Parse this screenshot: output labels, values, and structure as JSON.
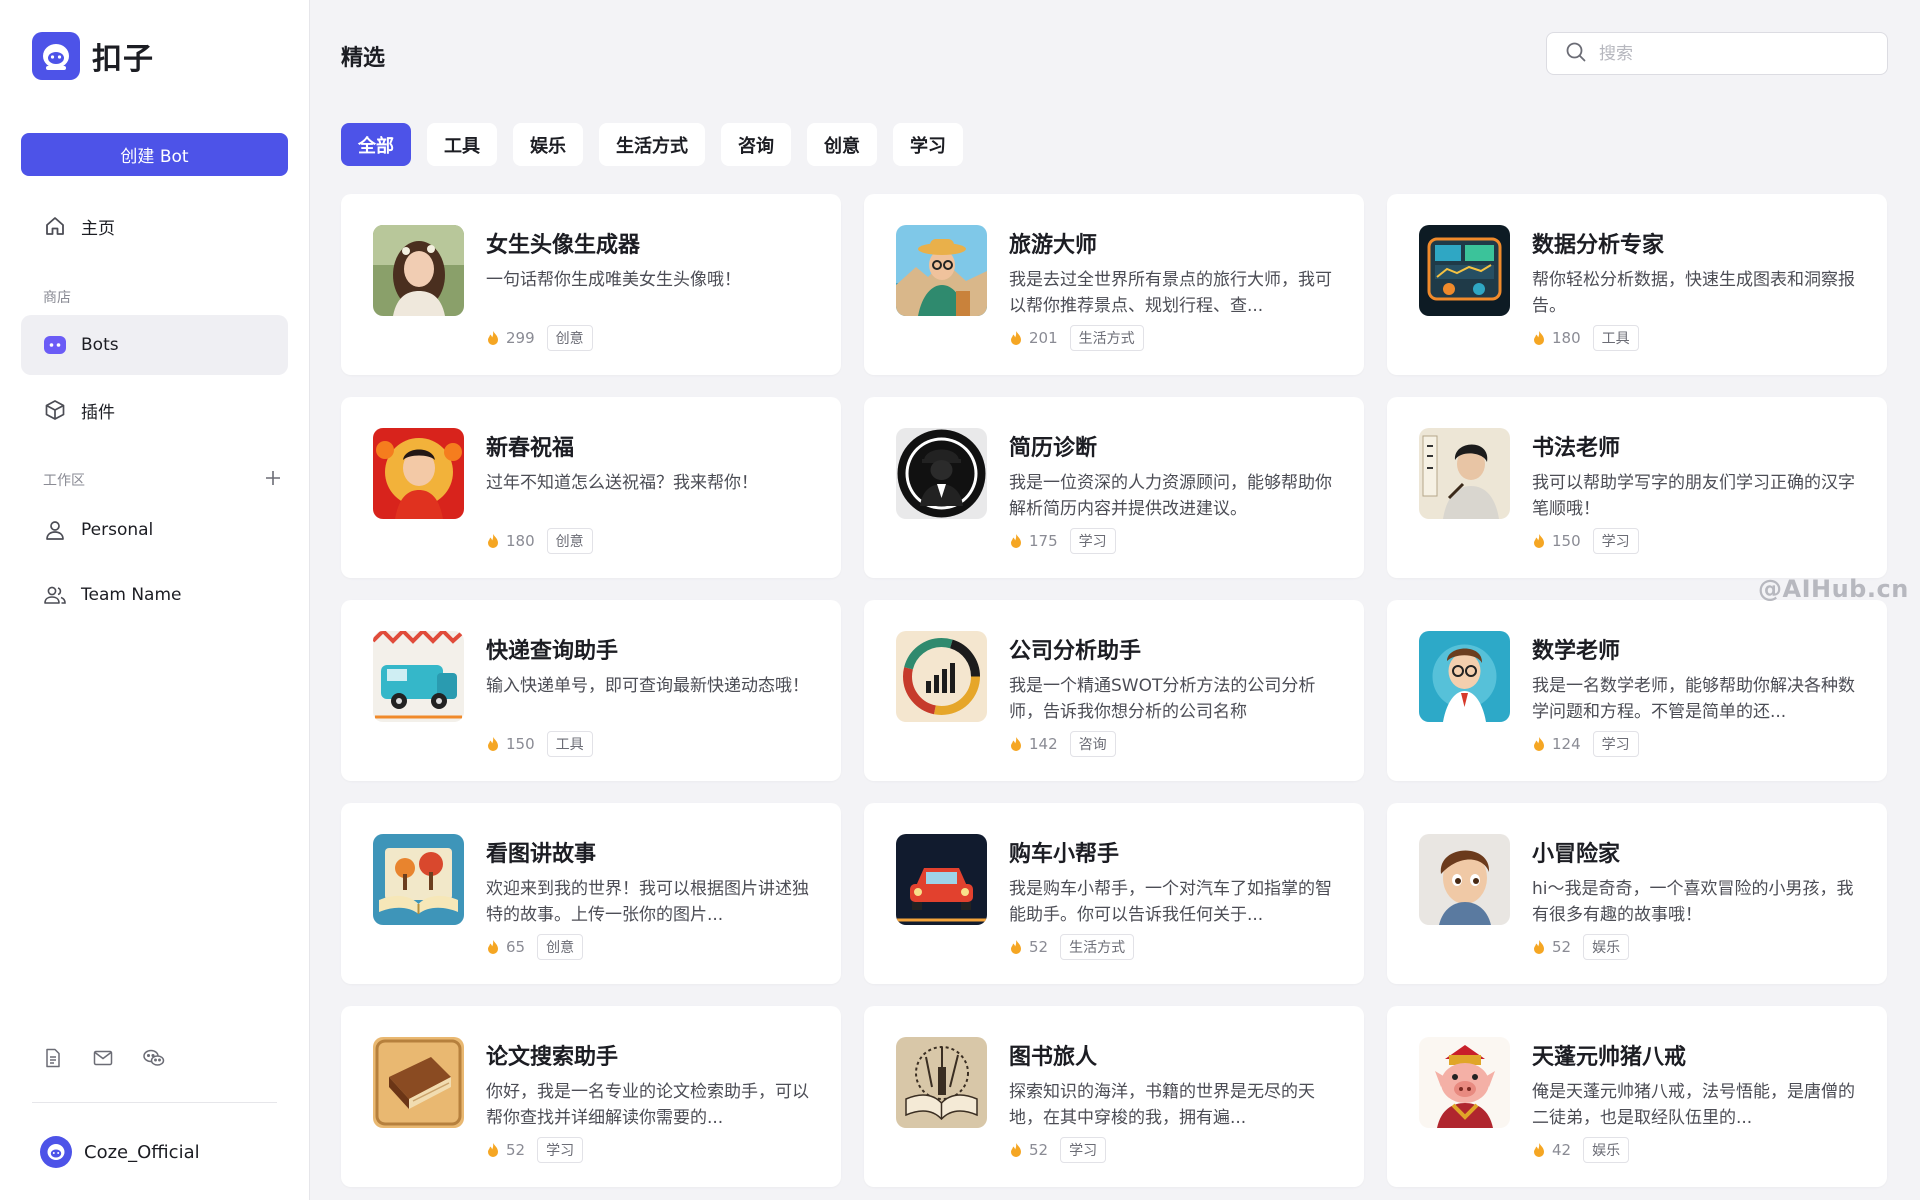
{
  "app": {
    "logo_text": "扣子"
  },
  "sidebar": {
    "create_button": "创建 Bot",
    "home": "主页",
    "store_label": "商店",
    "bots": "Bots",
    "plugins": "插件",
    "workspace_label": "工作区",
    "personal": "Personal",
    "team": "Team Name",
    "user_name": "Coze_Official"
  },
  "header": {
    "title": "精选",
    "search_placeholder": "搜索"
  },
  "tabs": [
    "全部",
    "工具",
    "娱乐",
    "生活方式",
    "咨询",
    "创意",
    "学习"
  ],
  "active_tab": "全部",
  "watermark": "@AIHub.cn",
  "colors": {
    "accent": "#4d53e8",
    "flame": "#f5a623"
  },
  "cards": [
    {
      "title": "女生头像生成器",
      "desc": "一句话帮你生成唯美女生头像哦！",
      "count": "299",
      "tag": "创意",
      "icon": "girl-portrait-image"
    },
    {
      "title": "旅游大师",
      "desc": "我是去过全世界所有景点的旅行大师，我可以帮你推荐景点、规划行程、查...",
      "count": "201",
      "tag": "生活方式",
      "icon": "traveler-avatar-image"
    },
    {
      "title": "数据分析专家",
      "desc": "帮你轻松分析数据，快速生成图表和洞察报告。",
      "count": "180",
      "tag": "工具",
      "icon": "data-dashboard-image"
    },
    {
      "title": "新春祝福",
      "desc": "过年不知道怎么送祝福？我来帮你！",
      "count": "180",
      "tag": "创意",
      "icon": "new-year-boy-image"
    },
    {
      "title": "简历诊断",
      "desc": "我是一位资深的人力资源顾问，能够帮助你解析简历内容并提供改进建议。",
      "count": "175",
      "tag": "学习",
      "icon": "hr-silhouette-image"
    },
    {
      "title": "书法老师",
      "desc": "我可以帮助学写字的朋友们学习正确的汉字笔顺哦！",
      "count": "150",
      "tag": "学习",
      "icon": "calligraphy-teacher-image"
    },
    {
      "title": "快递查询助手",
      "desc": "输入快递单号，即可查询最新快递动态哦！",
      "count": "150",
      "tag": "工具",
      "icon": "delivery-van-image"
    },
    {
      "title": "公司分析助手",
      "desc": "我是一个精通SWOT分析方法的公司分析师，告诉我你想分析的公司名称",
      "count": "142",
      "tag": "咨询",
      "icon": "company-chart-image"
    },
    {
      "title": "数学老师",
      "desc": "我是一名数学老师，能够帮助你解决各种数学问题和方程。不管是简单的还...",
      "count": "124",
      "tag": "学习",
      "icon": "math-teacher-image"
    },
    {
      "title": "看图讲故事",
      "desc": "欢迎来到我的世界！我可以根据图片讲述独特的故事。上传一张你的图片...",
      "count": "65",
      "tag": "创意",
      "icon": "story-book-image"
    },
    {
      "title": "购车小帮手",
      "desc": "我是购车小帮手，一个对汽车了如指掌的智能助手。你可以告诉我任何关于...",
      "count": "52",
      "tag": "生活方式",
      "icon": "red-car-image"
    },
    {
      "title": "小冒险家",
      "desc": "hi～我是奇奇，一个喜欢冒险的小男孩，我有很多有趣的故事哦！",
      "count": "52",
      "tag": "娱乐",
      "icon": "adventure-boy-image"
    },
    {
      "title": "论文搜索助手",
      "desc": "你好，我是一名专业的论文检索助手，可以帮你查找并详细解读你需要的...",
      "count": "52",
      "tag": "学习",
      "icon": "old-book-image"
    },
    {
      "title": "图书旅人",
      "desc": "探索知识的海洋，书籍的世界是无尽的天地，在其中穿梭的我，拥有遍...",
      "count": "52",
      "tag": "学习",
      "icon": "book-traveler-image"
    },
    {
      "title": "天蓬元帅猪八戒",
      "desc": "俺是天蓬元帅猪八戒，法号悟能，是唐僧的二徒弟，也是取经队伍里的...",
      "count": "42",
      "tag": "娱乐",
      "icon": "zhu-bajie-image"
    }
  ]
}
